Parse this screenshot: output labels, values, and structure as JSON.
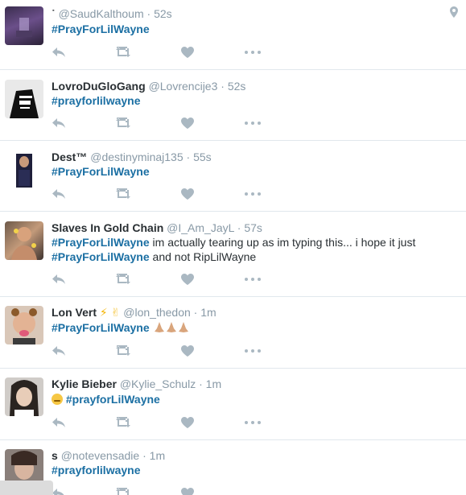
{
  "tweets": [
    {
      "name": "",
      "handle": "@SaudKalthoum",
      "time": "52s",
      "text_hashtag": "#PrayForLilWayne",
      "has_location": true
    },
    {
      "name": "LovroDuGloGang",
      "handle": "@Lovrencije3",
      "time": "52s",
      "text_hashtag": "#prayforlilwayne"
    },
    {
      "name": "Dest™",
      "handle": "@destinyminaj135",
      "time": "55s",
      "text_hashtag": "#PrayForLilWayne"
    },
    {
      "name": "Slaves In Gold Chain",
      "handle": "@I_Am_JayL",
      "time": "57s",
      "text_hashtag": "#PrayForLilWayne",
      "text_line1_rest": " im actually tearing up as im typing this... i hope it just",
      "text_line2_hashtag": "#PrayForLilWayne",
      "text_line2_rest": " and not RipLilWayne"
    },
    {
      "name": "Lon Vert",
      "handle": "@lon_thedon",
      "time": "1m",
      "text_hashtag": "#PrayForLilWayne"
    },
    {
      "name": "Kylie Bieber",
      "handle": "@Kylie_Schulz",
      "time": "1m",
      "text_hashtag": "#prayforLilWayne"
    },
    {
      "name": "s",
      "handle": "@notevensadie",
      "time": "1m",
      "text_hashtag": "#prayforlilwayne"
    }
  ],
  "separator": "·",
  "icons": {
    "reply": "reply-icon",
    "retweet": "retweet-icon",
    "like": "heart-icon",
    "more": "more-icon",
    "location": "location-pin-icon"
  },
  "colors": {
    "hashtag": "#1b6fa3",
    "meta": "#8899a6",
    "action": "#8899a6",
    "divider": "#e1e8ed"
  }
}
